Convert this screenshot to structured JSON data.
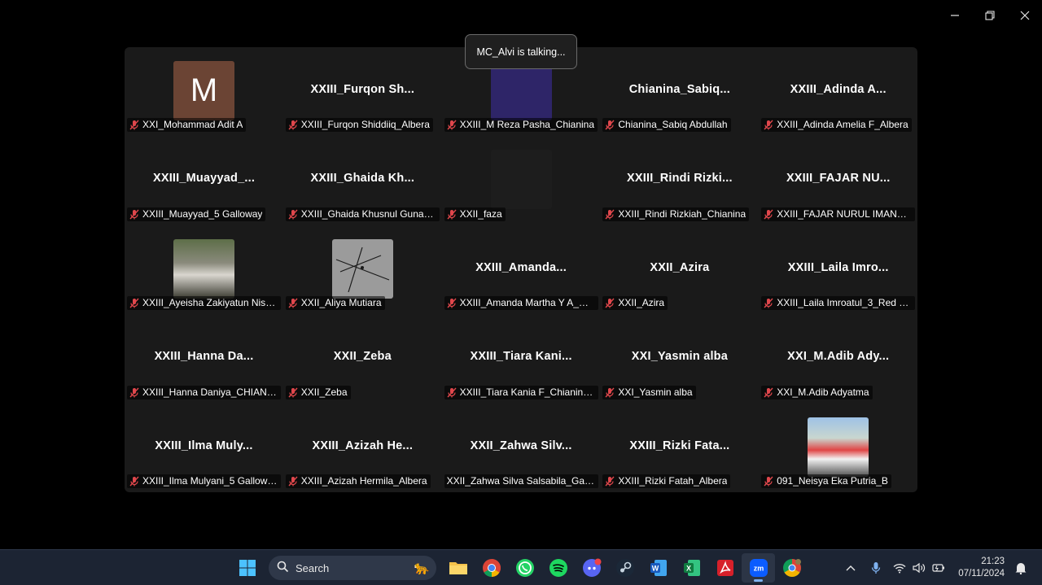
{
  "window": {
    "minimize_icon": "minimize-icon",
    "restore_icon": "restore-icon",
    "close_icon": "close-icon"
  },
  "toast": {
    "text": "MC_Alvi is talking..."
  },
  "participants": [
    {
      "display": "",
      "label": "XXI_Mohammad Adit A",
      "avatar": "letter",
      "letter": "M",
      "muted": true
    },
    {
      "display": "XXIII_Furqon  Sh...",
      "label": "XXIII_Furqon Shiddiiq_Albera",
      "muted": true
    },
    {
      "display": "",
      "label": "XXIII_M Reza Pasha_Chianina",
      "avatar": "purple",
      "muted": true
    },
    {
      "display": "Chianina_Sabiq...",
      "label": "Chianina_Sabiq Abdullah",
      "muted": true
    },
    {
      "display": "XXIII_Adinda  A...",
      "label": "XXIII_Adinda Amelia F_Albera",
      "muted": true
    },
    {
      "display": "XXIII_Muayyad_...",
      "label": "XXIII_Muayyad_5 Galloway",
      "muted": true
    },
    {
      "display": "XXIII_Ghaida  Kh...",
      "label": "XXIII_Ghaida Khusnul Gunani ...",
      "muted": true
    },
    {
      "display": "",
      "label": "XXII_faza",
      "avatar": "dark",
      "muted": true
    },
    {
      "display": "XXIII_Rindi  Rizki...",
      "label": "XXIII_Rindi Rizkiah_Chianina",
      "muted": true
    },
    {
      "display": "XXIII_FAJAR  NU...",
      "label": "XXIII_FAJAR NURUL IMAN_RE...",
      "muted": true
    },
    {
      "display": "",
      "label": "XXIII_Ayeisha Zakiyatun Niswa...",
      "avatar": "hijab",
      "muted": true
    },
    {
      "display": "",
      "label": "XXII_Aliya Mutiara",
      "avatar": "umbrella",
      "muted": true
    },
    {
      "display": "XXIII_Amanda...",
      "label": "XXIII_Amanda Martha Y A_Gall...",
      "muted": true
    },
    {
      "display": "XXII_Azira",
      "label": "XXII_Azira",
      "muted": true
    },
    {
      "display": "XXIII_Laila  Imro...",
      "label": "XXIII_Laila Imroatul_3_Red Dev...",
      "muted": true
    },
    {
      "display": "XXIII_Hanna  Da...",
      "label": "XXIII_Hanna Daniya_CHIANINA",
      "muted": true
    },
    {
      "display": "XXII_Zeba",
      "label": "XXII_Zeba",
      "muted": true
    },
    {
      "display": "XXIII_Tiara  Kani...",
      "label": "XXIII_Tiara Kania F_Chianina(4)",
      "muted": true
    },
    {
      "display": "XXI_Yasmin alba",
      "label": "XXI_Yasmin alba",
      "muted": true
    },
    {
      "display": "XXI_M.Adib  Ady...",
      "label": "XXI_M.Adib Adyatma",
      "muted": true
    },
    {
      "display": "XXIII_Ilma  Muly...",
      "label": "XXIII_Ilma Mulyani_5 Galloway",
      "muted": true
    },
    {
      "display": "XXIII_Azizah  He...",
      "label": "XXIII_Azizah Hermila_Albera",
      "muted": true
    },
    {
      "display": "XXII_Zahwa  Silv...",
      "label": "XXII_Zahwa Silva Salsabila_Gallo...",
      "muted": false
    },
    {
      "display": "XXIII_Rizki  Fata...",
      "label": "XXIII_Rizki Fatah_Albera",
      "muted": true
    },
    {
      "display": "",
      "label": "091_Neisya Eka Putria_B",
      "avatar": "outdoor",
      "muted": true
    }
  ],
  "taskbar": {
    "search_label": "Search",
    "apps": [
      "windows-start-icon",
      "file-explorer-icon",
      "chrome-icon",
      "whatsapp-icon",
      "spotify-icon",
      "discord-icon",
      "steam-icon",
      "word-icon",
      "excel-icon",
      "acrobat-icon",
      "zoom-icon",
      "chrome-profile-icon"
    ],
    "time": "21:23",
    "date": "07/11/2024"
  },
  "colors": {
    "taskbar": "#1c2433",
    "gallery": "#1a1a1a",
    "muted_red": "#e0474c"
  }
}
